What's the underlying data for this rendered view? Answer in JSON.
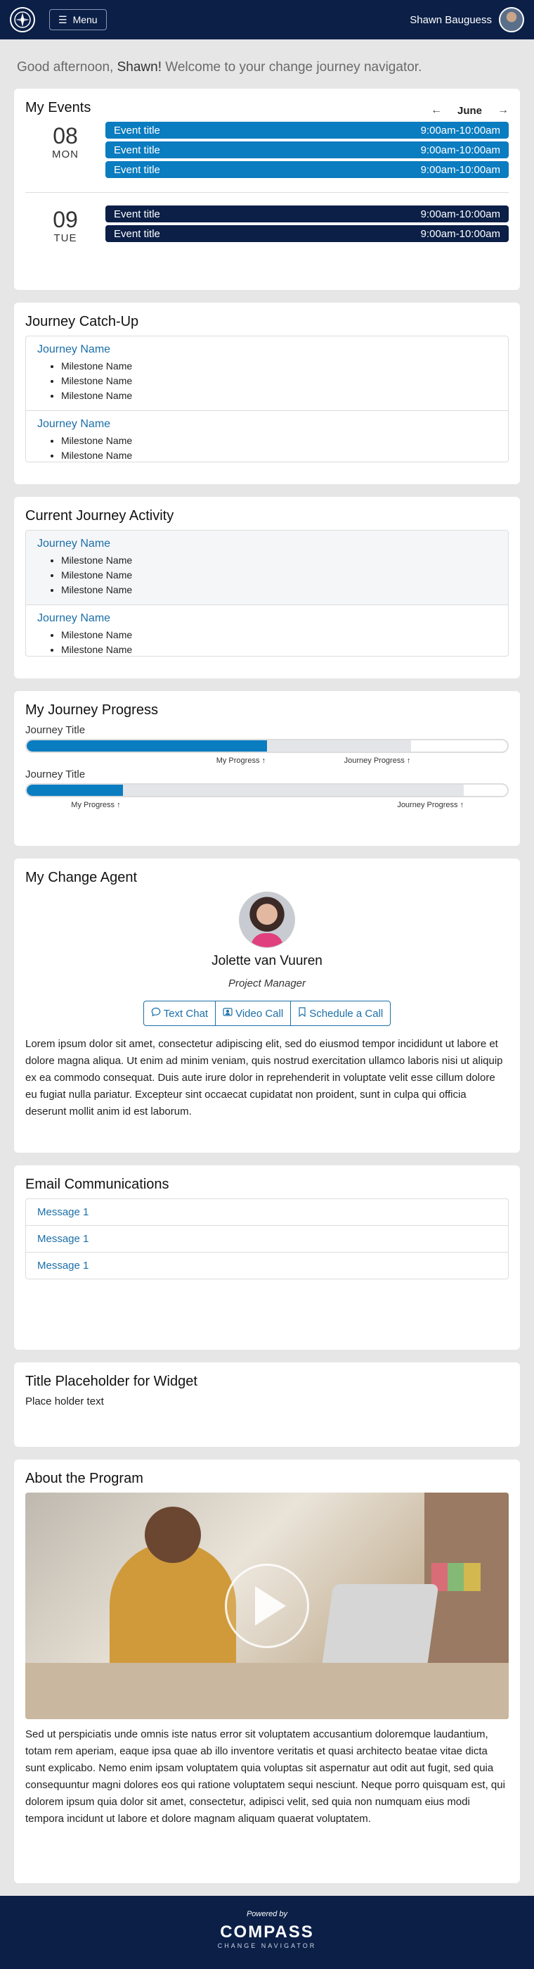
{
  "header": {
    "menu_label": "Menu",
    "user_name": "Shawn Bauguess"
  },
  "greeting": {
    "prefix": "Good afternoon, ",
    "name": "Shawn!",
    "suffix": " Welcome to your change journey navigator."
  },
  "events": {
    "title": "My Events",
    "month": "June",
    "days": [
      {
        "num": "08",
        "name": "MON",
        "items": [
          {
            "title": "Event title",
            "time": "9:00am-10:00am"
          },
          {
            "title": "Event title",
            "time": "9:00am-10:00am"
          },
          {
            "title": "Event title",
            "time": "9:00am-10:00am"
          }
        ]
      },
      {
        "num": "09",
        "name": "TUE",
        "items": [
          {
            "title": "Event title",
            "time": "9:00am-10:00am"
          },
          {
            "title": "Event title",
            "time": "9:00am-10:00am"
          }
        ]
      }
    ]
  },
  "catchup": {
    "title": "Journey Catch-Up",
    "items": [
      {
        "name": "Journey Name",
        "milestones": [
          "Milestone Name",
          "Milestone Name",
          "Milestone Name"
        ]
      },
      {
        "name": "Journey Name",
        "milestones": [
          "Milestone Name",
          "Milestone Name"
        ]
      }
    ]
  },
  "activity": {
    "title": "Current Journey Activity",
    "items": [
      {
        "name": "Journey Name",
        "milestones": [
          "Milestone Name",
          "Milestone Name",
          "Milestone Name"
        ]
      },
      {
        "name": "Journey Name",
        "milestones": [
          "Milestone Name",
          "Milestone Name"
        ]
      }
    ]
  },
  "progress": {
    "title": "My Journey Progress",
    "my_label": "My Progress ↑",
    "journey_label": "Journey Progress ↑",
    "journeys": [
      {
        "title": "Journey Title",
        "my_progress": 0.5,
        "journey_progress": 0.8
      },
      {
        "title": "Journey Title",
        "my_progress": 0.2,
        "journey_progress": 0.91
      }
    ]
  },
  "agent": {
    "title": "My Change Agent",
    "name": "Jolette van Vuuren",
    "role": "Project Manager",
    "buttons": {
      "text": "Text Chat",
      "video": "Video Call",
      "schedule": "Schedule a Call"
    },
    "bio": "Lorem ipsum dolor sit amet, consectetur adipiscing elit, sed do eiusmod tempor incididunt ut labore et dolore magna aliqua. Ut enim ad minim veniam, quis nostrud exercitation ullamco laboris nisi ut aliquip ex ea commodo consequat. Duis aute irure dolor in reprehenderit in voluptate velit esse cillum dolore eu fugiat nulla pariatur. Excepteur sint occaecat cupidatat non proident, sunt in culpa qui officia deserunt mollit anim id est laborum."
  },
  "email": {
    "title": "Email Communications",
    "messages": [
      "Message 1",
      "Message 1",
      "Message 1"
    ]
  },
  "placeholder": {
    "title": "Title Placeholder for Widget",
    "text": "Place holder text"
  },
  "about": {
    "title": "About the Program",
    "text": "Sed ut perspiciatis unde omnis iste natus error sit voluptatem accusantium doloremque laudantium, totam rem aperiam, eaque ipsa quae ab illo inventore veritatis et quasi architecto beatae vitae dicta sunt explicabo. Nemo enim ipsam voluptatem quia voluptas sit aspernatur aut odit aut fugit, sed quia consequuntur magni dolores eos qui ratione voluptatem sequi nesciunt. Neque porro quisquam est, qui dolorem ipsum quia dolor sit amet, consectetur, adipisci velit, sed quia non numquam eius modi tempora incidunt ut labore et dolore magnam aliquam quaerat voluptatem."
  },
  "footer": {
    "powered": "Powered by",
    "brand": "COMPASS",
    "sub": "CHANGE NAVIGATOR"
  },
  "colors": {
    "navy": "#0b1f47",
    "accent": "#0a7cc0",
    "link": "#1b6fa8"
  }
}
